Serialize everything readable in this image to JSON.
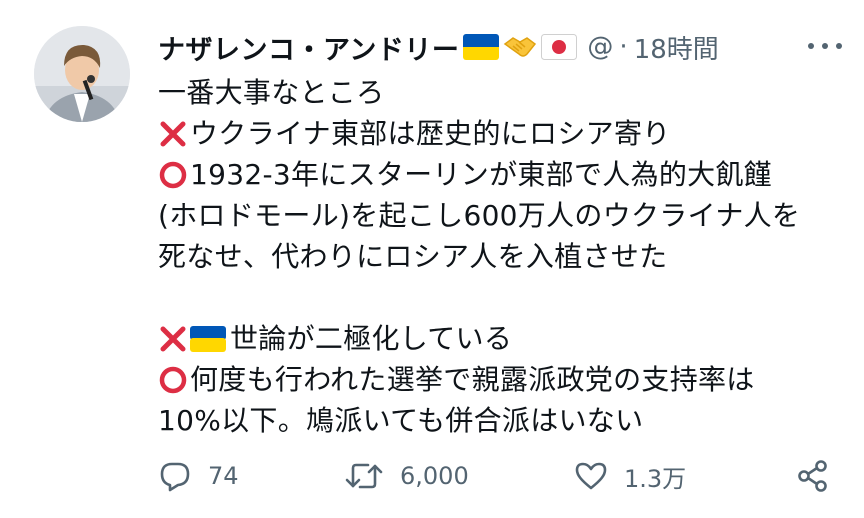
{
  "author": {
    "name": "ナザレンコ・アンドリー",
    "badges": [
      "ukraine-flag",
      "handshake",
      "japan-flag"
    ],
    "handle": "@",
    "separator": "·",
    "time": "18時間"
  },
  "tweet": {
    "lines": [
      {
        "mark": "cross",
        "text": "",
        "plain": "一番大事なところ"
      },
      {
        "mark": "cross",
        "text": "ウクライナ東部は歴史的にロシア寄り"
      },
      {
        "mark": "circle",
        "text": "1932-3年にスターリンが東部で人為的大飢饉"
      },
      {
        "text": "(ホロドモール)を起こし600万人のウクライナ人を"
      },
      {
        "text": "死なせ、代わりにロシア人を入植させた"
      },
      {
        "mark": "cross",
        "flag": "ukraine-flag",
        "text": "世論が二極化している"
      },
      {
        "mark": "circle",
        "text": "何度も行われた選挙で親露派政党の支持率は"
      },
      {
        "text": "10%以下。鳩派いても併合派はいない"
      }
    ]
  },
  "stats": {
    "replies": "74",
    "retweets": "6,000",
    "likes": "1.3万"
  },
  "colors": {
    "cross": "#dd2e44",
    "circle": "#dd2e44",
    "muted": "#536471",
    "ukraine_blue": "#0057b7",
    "ukraine_yellow": "#ffd700"
  }
}
